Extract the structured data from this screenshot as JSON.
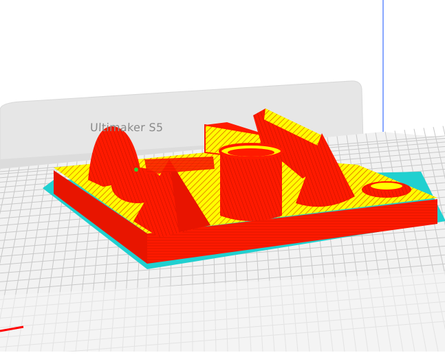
{
  "viewport": {
    "printer_name": "Ultimaker S5",
    "colors": {
      "background": "#ffffff",
      "back_wall": "#e6e6e6",
      "build_plate": "#f2f2f2",
      "grid_line": "#c8c8c8",
      "walls": "#ff1a00",
      "infill": "#ffff00",
      "skirt": "#20d0d0",
      "axis_blue": "#3a6dff",
      "axis_red": "#ff0000"
    },
    "icons": [
      "printer-model-icon"
    ]
  }
}
